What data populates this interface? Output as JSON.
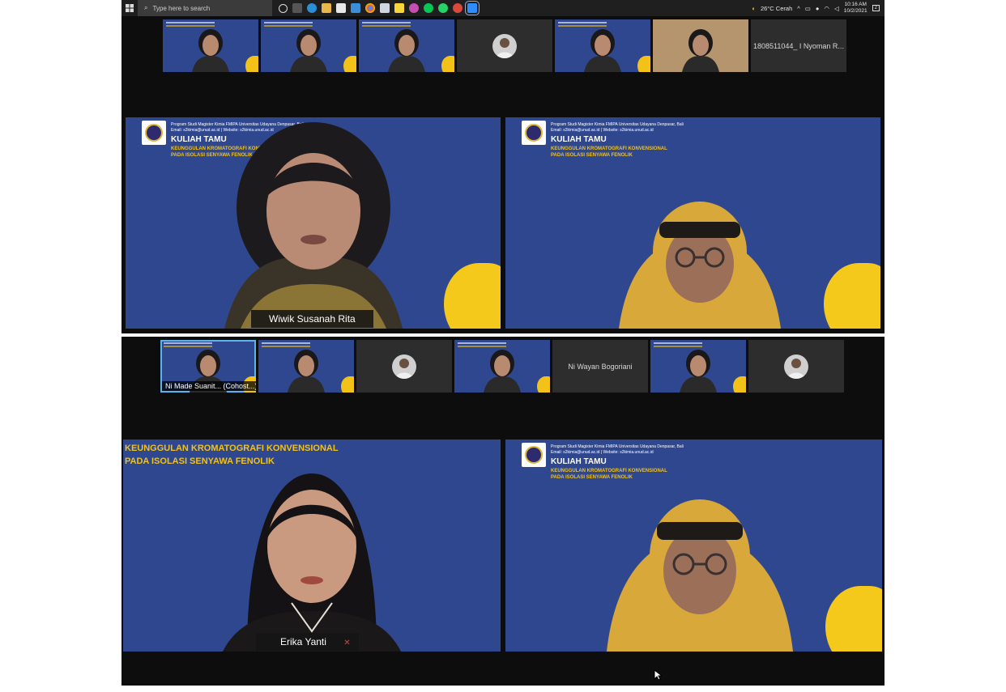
{
  "taskbar": {
    "search_placeholder": "Type here to search",
    "weather": "26°C  Cerah",
    "time": "10:16 AM",
    "date": "10/2/2021",
    "notification_count": "2"
  },
  "top": {
    "thumbnails": [
      {
        "kind": "video",
        "bg": "blue"
      },
      {
        "kind": "video",
        "bg": "blue"
      },
      {
        "kind": "video",
        "bg": "blue"
      },
      {
        "kind": "avatar",
        "bg": "gray"
      },
      {
        "kind": "video",
        "bg": "blue"
      },
      {
        "kind": "video",
        "bg": "room"
      },
      {
        "kind": "name",
        "bg": "gray",
        "name": "1808511044_ I Nyoman R..."
      }
    ],
    "left_tile": {
      "org": "Program Studi Magister Kimia FMIPA Universitas Udayana Denpasar, Bali",
      "email": "Email: s2kimia@unud.ac.id  |  Website: s2kimia.unud.ac.id",
      "title": "KULIAH TAMU",
      "subtitle1": "KEUNGGULAN KROMATOGRAFI KONVENSIONAL",
      "subtitle2": "PADA ISOLASI SENYAWA FENOLIK",
      "speaker": "Wiwik Susanah Rita"
    },
    "right_tile": {
      "org": "Program Studi Magister Kimia FMIPA Universitas Udayana Denpasar, Bali",
      "email": "Email: s2kimia@unud.ac.id  |  Website: s2kimia.unud.ac.id",
      "title": "KULIAH TAMU",
      "subtitle1": "KEUNGGULAN KROMATOGRAFI KONVENSIONAL",
      "subtitle2": "PADA ISOLASI SENYAWA FENOLIK"
    }
  },
  "bottom": {
    "thumbnails": [
      {
        "kind": "video",
        "bg": "blue",
        "name": "Ni Made Suanit... (Cohost...)",
        "selected": true
      },
      {
        "kind": "video",
        "bg": "blue"
      },
      {
        "kind": "avatar",
        "bg": "gray"
      },
      {
        "kind": "video",
        "bg": "blue"
      },
      {
        "kind": "name",
        "bg": "gray",
        "name": "Ni Wayan Bogoriani"
      },
      {
        "kind": "video",
        "bg": "blue"
      },
      {
        "kind": "avatar",
        "bg": "gray"
      }
    ],
    "left_tile": {
      "subtitle1": "KEUNGGULAN KROMATOGRAFI KONVENSIONAL",
      "subtitle2": "PADA ISOLASI SENYAWA FENOLIK",
      "speaker": "Erika Yanti"
    },
    "right_tile": {
      "org": "Program Studi Magister Kimia FMIPA Universitas Udayana Denpasar, Bali",
      "email": "Email: s2kimia@unud.ac.id  |  Website: s2kimia.unud.ac.id",
      "title": "KULIAH TAMU",
      "subtitle1": "KEUNGGULAN KROMATOGRAFI KONVENSIONAL",
      "subtitle2": "PADA ISOLASI SENYAWA FENOLIK"
    }
  },
  "colors": {
    "background_blue": "#2f478e",
    "accent_yellow": "#f5c81c",
    "selected_border": "#5ab4e6"
  }
}
